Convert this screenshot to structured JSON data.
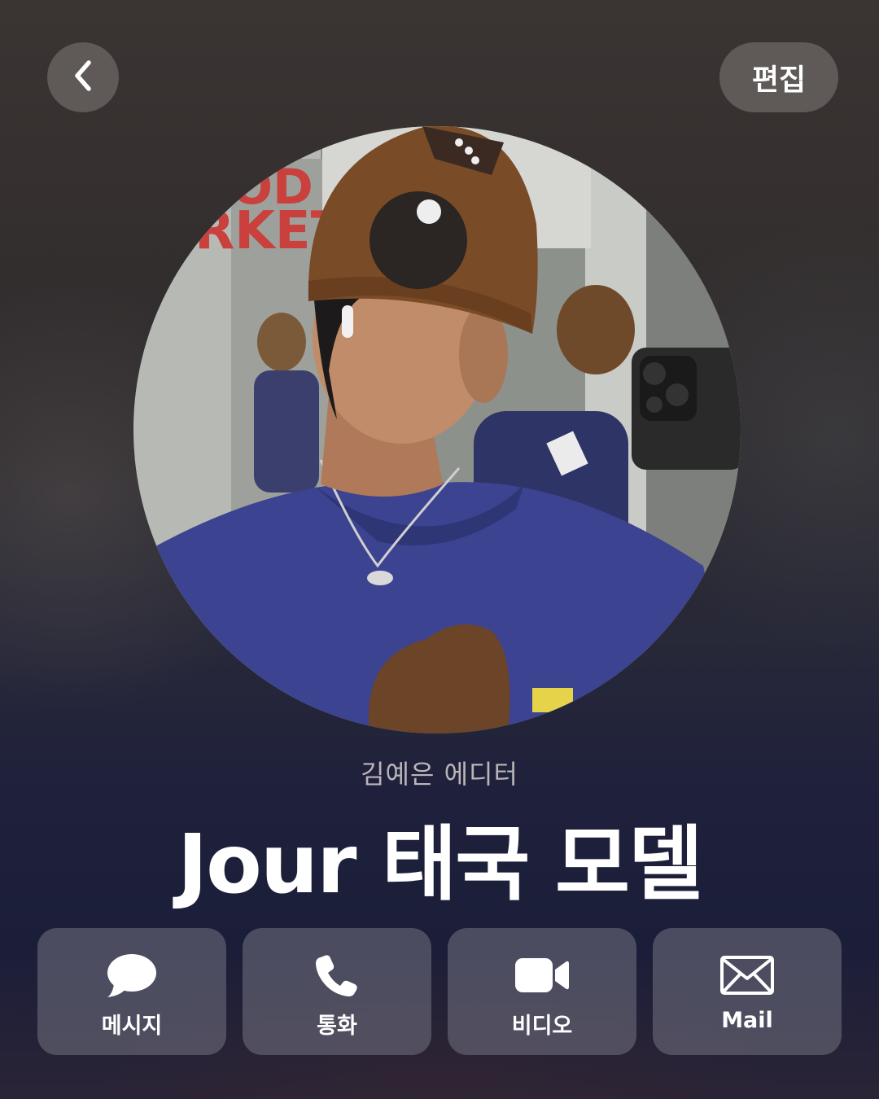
{
  "header": {
    "back_icon": "chevron-left-icon",
    "edit_label": "편집"
  },
  "profile": {
    "avatar": "profile-photo",
    "subtitle": "김예은 에디터",
    "name": "Jour 태국 모델"
  },
  "actions": [
    {
      "label": "메시지",
      "icon": "message-bubble-icon"
    },
    {
      "label": "통화",
      "icon": "phone-icon"
    },
    {
      "label": "비디오",
      "icon": "video-camera-icon"
    },
    {
      "label": "Mail",
      "icon": "envelope-icon"
    }
  ],
  "colors": {
    "button_bg": "#6f6b74",
    "text_primary": "#ffffff",
    "text_secondary": "#b9b5b9"
  }
}
